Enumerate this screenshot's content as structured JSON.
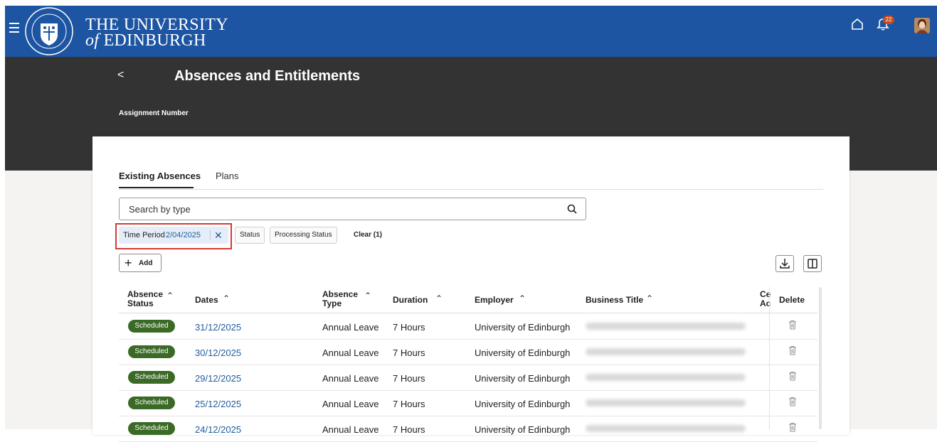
{
  "header": {
    "logo_line1": "THE UNIVERSITY",
    "logo_line2_of": "of",
    "logo_line2_name": "EDINBURGH",
    "notification_count": "22",
    "icons": [
      "hamburger-icon",
      "university-crest-logo",
      "home-icon",
      "bell-icon",
      "avatar"
    ]
  },
  "page": {
    "back_label": "<",
    "title": "Absences and Entitlements",
    "assignment_label": "Assignment Number"
  },
  "tabs": [
    {
      "label": "Existing Absences",
      "active": true
    },
    {
      "label": "Plans",
      "active": false
    }
  ],
  "search": {
    "placeholder": "Search by type"
  },
  "filters": {
    "time_period_label": "Time Period",
    "time_period_value": "2/04/2025",
    "status_label": "Status",
    "processing_status_label": "Processing Status",
    "clear_label": "Clear (1)"
  },
  "toolbar": {
    "add_label": "Add"
  },
  "table": {
    "columns": {
      "absence_status_1": "Absence",
      "absence_status_2": "Status",
      "dates": "Dates",
      "absence_type_1": "Absence",
      "absence_type_2": "Type",
      "duration": "Duration",
      "employer": "Employer",
      "business_title": "Business Title",
      "cut_1": "Ce",
      "cut_2": "Ac",
      "delete": "Delete"
    },
    "rows": [
      {
        "status": "Scheduled",
        "date": "31/12/2025",
        "type": "Annual Leave",
        "duration": "7 Hours",
        "employer": "University of Edinburgh"
      },
      {
        "status": "Scheduled",
        "date": "30/12/2025",
        "type": "Annual Leave",
        "duration": "7 Hours",
        "employer": "University of Edinburgh"
      },
      {
        "status": "Scheduled",
        "date": "29/12/2025",
        "type": "Annual Leave",
        "duration": "7 Hours",
        "employer": "University of Edinburgh"
      },
      {
        "status": "Scheduled",
        "date": "25/12/2025",
        "type": "Annual Leave",
        "duration": "7 Hours",
        "employer": "University of Edinburgh"
      },
      {
        "status": "Scheduled",
        "date": "24/12/2025",
        "type": "Annual Leave",
        "duration": "7 Hours",
        "employer": "University of Edinburgh"
      }
    ]
  },
  "colors": {
    "brand_blue": "#1d55a3",
    "hero_dark": "#333333",
    "status_green": "#3a6a25",
    "link_blue": "#1f5d9e",
    "highlight_red": "#d43a34"
  }
}
